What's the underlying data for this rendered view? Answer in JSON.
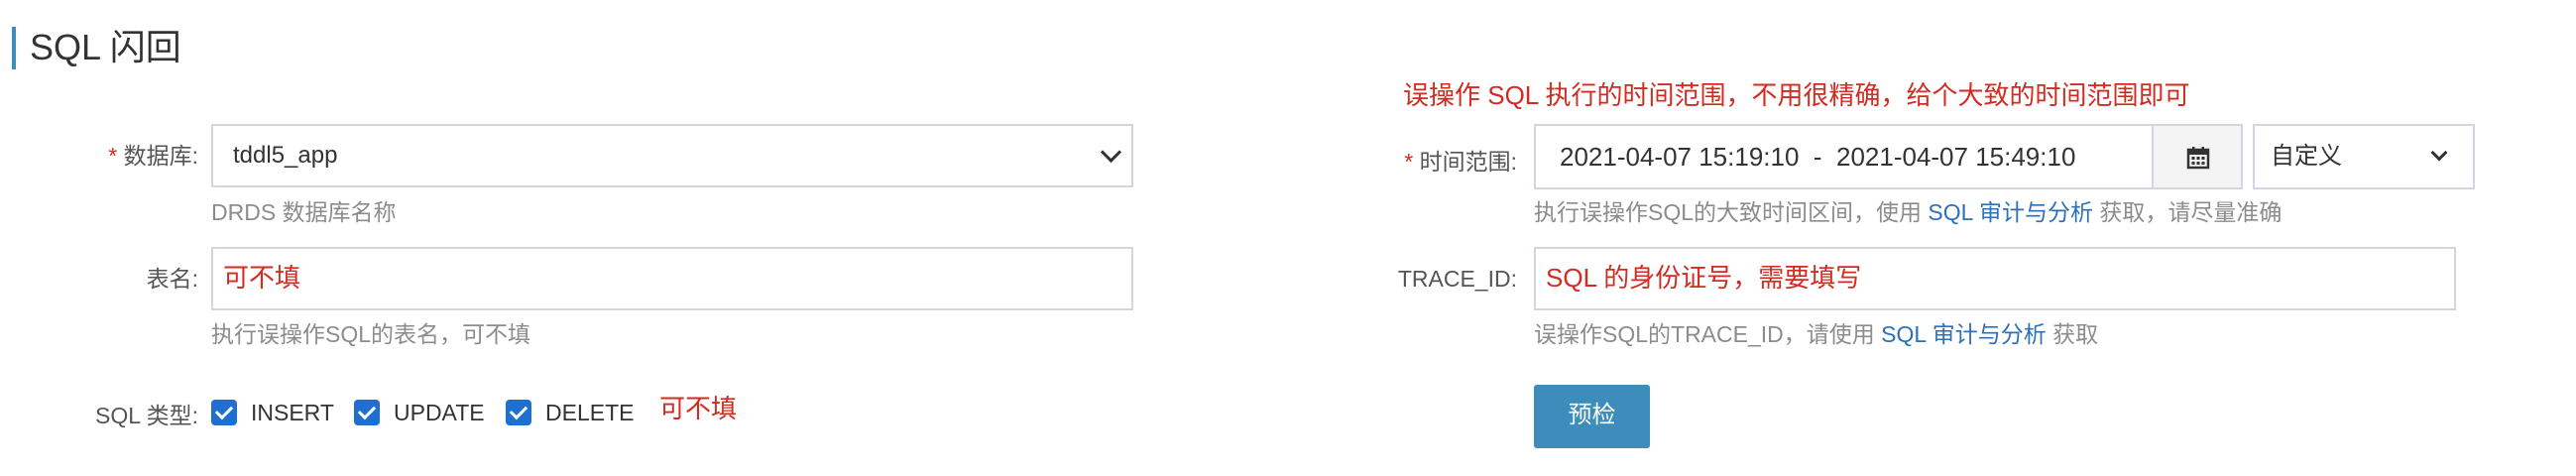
{
  "page": {
    "title": "SQL 闪回"
  },
  "form": {
    "database": {
      "required_mark": "*",
      "label": "数据库:",
      "selected": "tddl5_app",
      "help": "DRDS 数据库名称"
    },
    "table": {
      "label": "表名:",
      "value": "可不填",
      "help": "执行误操作SQL的表名，可不填"
    },
    "sql_type": {
      "label": "SQL 类型:",
      "options": [
        {
          "label": "INSERT",
          "checked": true
        },
        {
          "label": "UPDATE",
          "checked": true
        },
        {
          "label": "DELETE",
          "checked": true
        }
      ],
      "note": "可不填"
    },
    "time_range": {
      "annotation": "误操作 SQL 执行的时间范围，不用很精确，给个大致的时间范围即可",
      "required_mark": "*",
      "label": "时间范围:",
      "value": "2021-04-07 15:19:10  -  2021-04-07 15:49:10",
      "calendar_icon": "calendar-icon",
      "range_mode": "自定义",
      "help_prefix": "执行误操作SQL的大致时间区间，使用 ",
      "help_link": "SQL 审计与分析",
      "help_suffix": " 获取，请尽量准确"
    },
    "trace_id": {
      "label": "TRACE_ID:",
      "value": "SQL 的身份证号，需要填写",
      "help_prefix": "误操作SQL的TRACE_ID，请使用 ",
      "help_link": "SQL 审计与分析",
      "help_suffix": " 获取"
    },
    "precheck_button": "预检"
  },
  "colors": {
    "accent": "#3c8dbc",
    "required": "#c7311f",
    "annotation_red": "#d22b21",
    "link": "#2c71b8",
    "checkbox": "#1f6fd0"
  }
}
